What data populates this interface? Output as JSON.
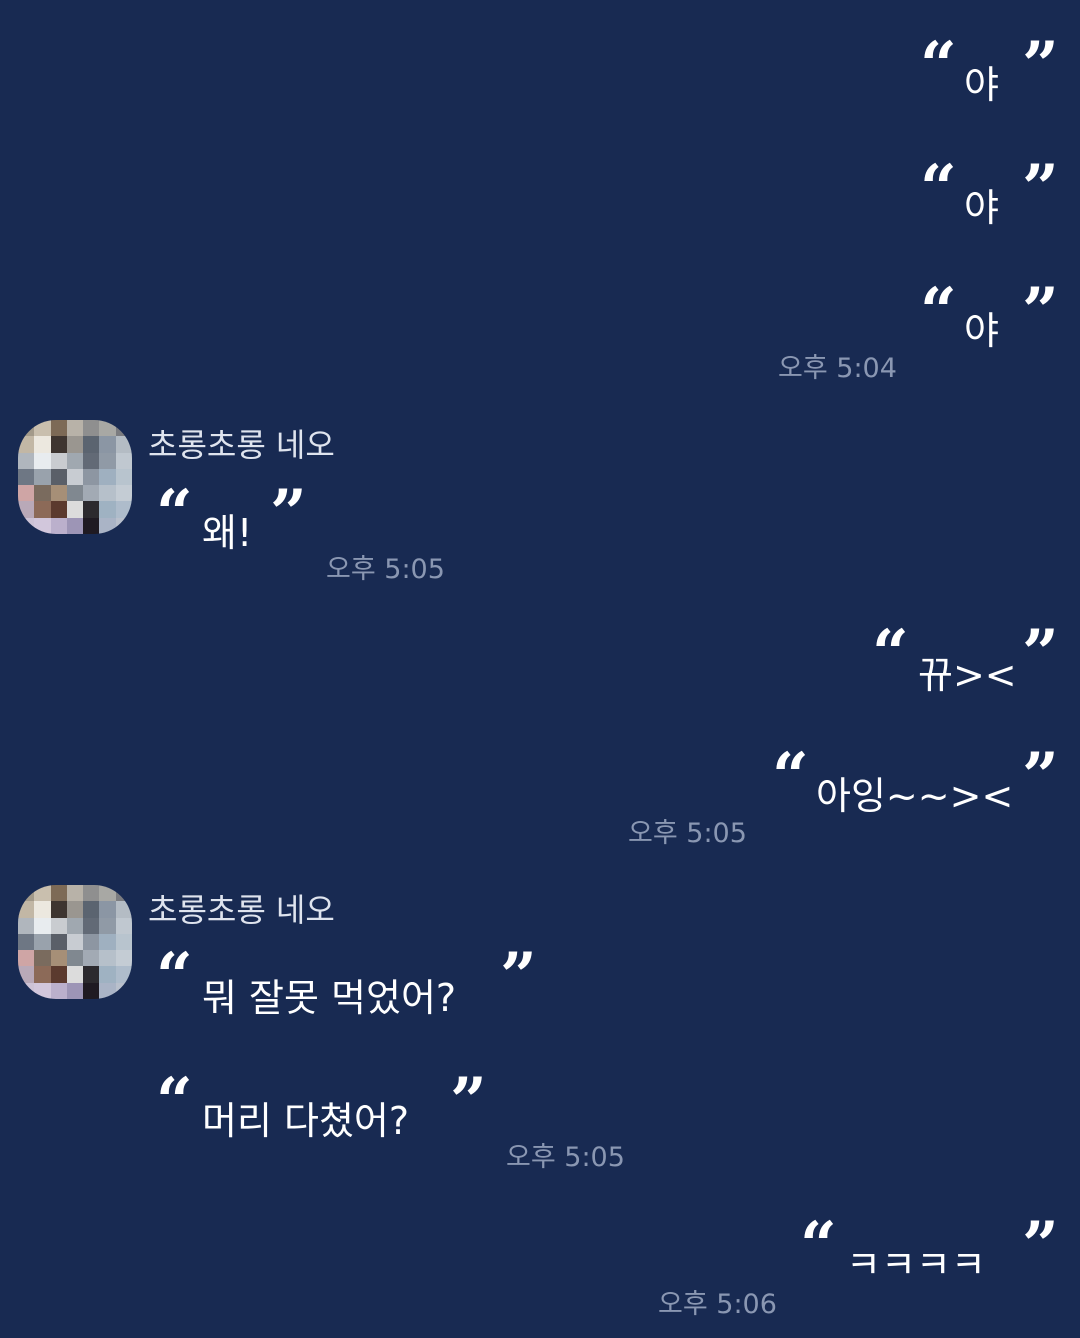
{
  "chat": {
    "sender_name": "초롱초롱 네오",
    "messages": [
      {
        "id": "m1",
        "side": "me",
        "text": "야"
      },
      {
        "id": "m2",
        "side": "me",
        "text": "야"
      },
      {
        "id": "m3",
        "side": "me",
        "text": "야",
        "time": "오후 5:04"
      },
      {
        "id": "m4",
        "side": "other",
        "text": "왜!",
        "time": "오후 5:05"
      },
      {
        "id": "m5",
        "side": "me",
        "text": "뀨><"
      },
      {
        "id": "m6",
        "side": "me",
        "text": "아잉~~><",
        "time": "오후 5:05"
      },
      {
        "id": "m7",
        "side": "other",
        "text": "뭐 잘못 먹었어?"
      },
      {
        "id": "m8",
        "side": "other",
        "text": "머리 다쳤어?",
        "time": "오후 5:05"
      },
      {
        "id": "m9",
        "side": "me",
        "text": "ㅋㅋㅋㅋ",
        "time": "오후 5:06"
      }
    ]
  },
  "quote_marks": {
    "open": "“",
    "close": "”"
  },
  "avatar": {
    "icon": "blurred-profile-avatar-icon",
    "pixels": [
      "#a39a8a",
      "#c9bfae",
      "#7d6a56",
      "#b8b2a8",
      "#8f8f8f",
      "#a8a8a4",
      "#7b7c80",
      "#c2b7a5",
      "#ece8df",
      "#3e3530",
      "#9a9690",
      "#5b6470",
      "#8b96a4",
      "#b4bcc4",
      "#b0b6bd",
      "#e8ecef",
      "#c9ccd0",
      "#a0a8b0",
      "#626a76",
      "#909aa6",
      "#c0c8d0",
      "#6e7784",
      "#99a2ac",
      "#5a5f68",
      "#c8ccd2",
      "#8d96a2",
      "#9fb0c0",
      "#b8c4ce",
      "#cfa5a5",
      "#7a6b5e",
      "#a68f77",
      "#808890",
      "#a2aab4",
      "#b6c0ca",
      "#c4ccd4",
      "#b9a9b8",
      "#8c6a58",
      "#5b3a2e",
      "#dcdcdc",
      "#2c2a2e",
      "#9fb2c2",
      "#aebccb",
      "#cdc3d6",
      "#d2c7dc",
      "#bbb0cc",
      "#9d95b6",
      "#1f1a22",
      "#aab4c6",
      "#b9c0cc"
    ]
  }
}
